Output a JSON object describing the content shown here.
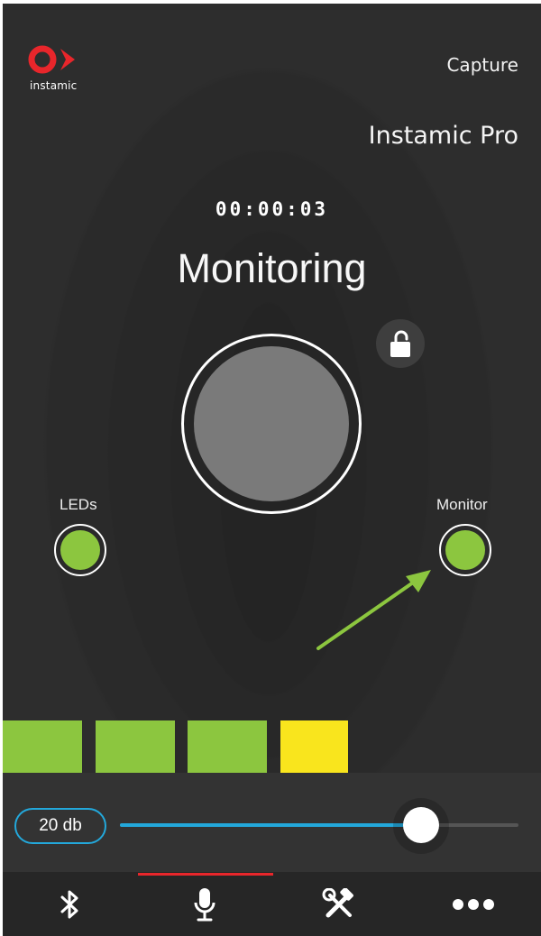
{
  "header": {
    "brand": "instamic",
    "capture_label": "Capture",
    "product_name": "Instamic Pro"
  },
  "recording": {
    "timer": "00:00:03",
    "status": "Monitoring"
  },
  "toggles": {
    "leds_label": "LEDs",
    "monitor_label": "Monitor"
  },
  "level_meter": {
    "lit_segments": 4,
    "colors": [
      "#8cc63f",
      "#8cc63f",
      "#8cc63f",
      "#f9e51d"
    ]
  },
  "gain": {
    "label": "20 db",
    "slider_fraction": 0.75
  },
  "tabs": [
    {
      "icon": "bluetooth-icon",
      "active": false
    },
    {
      "icon": "microphone-icon",
      "active": true
    },
    {
      "icon": "tools-icon",
      "active": false
    },
    {
      "icon": "more-icon",
      "active": false
    }
  ],
  "colors": {
    "brand": "#e8262b",
    "accent": "#23a8db",
    "on_green": "#8cc63f",
    "peak_yellow": "#f9e51d"
  }
}
